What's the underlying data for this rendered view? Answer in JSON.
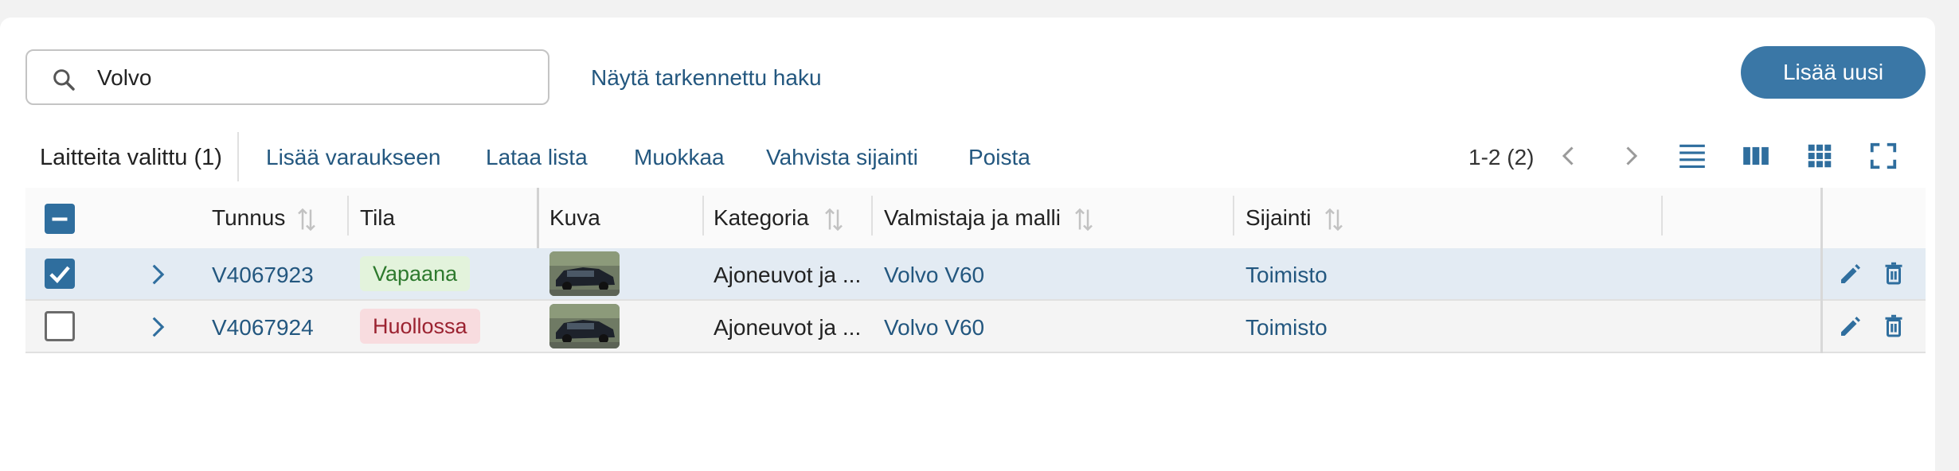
{
  "search": {
    "value": "Volvo",
    "icon": "search-icon"
  },
  "advanced_search_label": "Näytä tarkennettu haku",
  "add_new_label": "Lisää uusi",
  "toolbar": {
    "selected_label": "Laitteita valittu (1)",
    "actions": [
      "Lisää varaukseen",
      "Lataa lista",
      "Muokkaa",
      "Vahvista sijainti",
      "Poista"
    ],
    "pagination": "1-2 (2)"
  },
  "table": {
    "columns": [
      "Tunnus",
      "Tila",
      "Kuva",
      "Kategoria",
      "Valmistaja ja malli",
      "Sijainti"
    ],
    "rows": [
      {
        "checked": true,
        "code": "V4067923",
        "status": "Vapaana",
        "status_type": "free",
        "category": "Ajoneuvot ja ...",
        "model": "Volvo V60",
        "location": "Toimisto"
      },
      {
        "checked": false,
        "code": "V4067924",
        "status": "Huollossa",
        "status_type": "service",
        "category": "Ajoneuvot ja ...",
        "model": "Volvo V60",
        "location": "Toimisto"
      }
    ]
  },
  "colors": {
    "accent": "#3a77a6",
    "link": "#23577f",
    "selected_row": "#e3ebf3"
  }
}
